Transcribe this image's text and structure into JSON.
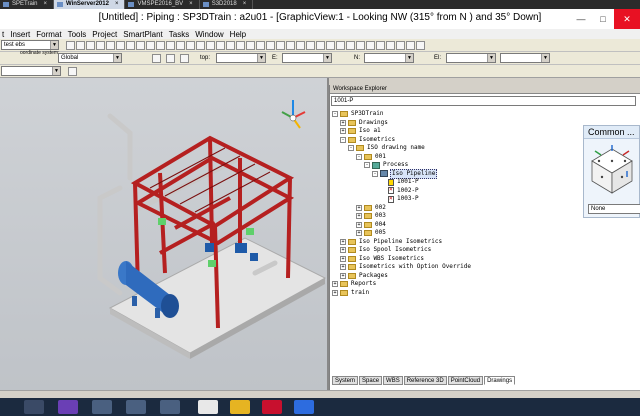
{
  "vm_tabs": [
    {
      "label": "SPETrain",
      "active": false
    },
    {
      "label": "WinServer2012",
      "active": true
    },
    {
      "label": "VMSPE2016_BV",
      "active": false
    },
    {
      "label": "S3D2018",
      "active": false
    }
  ],
  "window": {
    "title": "[Untitled] : Piping : SP3DTrain : a2u01 - [GraphicView:1 - Looking NW (315° from N ) and 35° Down]",
    "minimize": "—",
    "maximize": "□",
    "close": "✕"
  },
  "menu": [
    "t",
    "Insert",
    "Format",
    "Tools",
    "Project",
    "SmartPlant",
    "Tasks",
    "Window",
    "Help"
  ],
  "toolbar": {
    "filter_value": "test ebs",
    "coordinate_system_label": "oordinate system:",
    "coordinate_system_value": "Global",
    "top_label": "top:",
    "e_label": "E:",
    "n_label": "N:",
    "el_label": "El:"
  },
  "workspace_explorer": {
    "header": "Workspace Explorer",
    "search_value": "1001-P",
    "tree": [
      {
        "label": "SP3DTrain",
        "indent": 0,
        "kind": "root",
        "exp": "-"
      },
      {
        "label": "Drawings",
        "indent": 1,
        "kind": "folder",
        "exp": "+"
      },
      {
        "label": "Iso a1",
        "indent": 1,
        "kind": "folder",
        "exp": "+"
      },
      {
        "label": "Isometrics",
        "indent": 1,
        "kind": "folder",
        "exp": "-"
      },
      {
        "label": "ISO drawing name",
        "indent": 2,
        "kind": "folder",
        "exp": "-"
      },
      {
        "label": "001",
        "indent": 3,
        "kind": "folder",
        "exp": "-"
      },
      {
        "label": "Process",
        "indent": 4,
        "kind": "process",
        "exp": "-"
      },
      {
        "label": "Iso Pipeline",
        "indent": 5,
        "kind": "pipeline",
        "exp": "-",
        "selected": true
      },
      {
        "label": "1001-P",
        "indent": 6,
        "kind": "doc-yel"
      },
      {
        "label": "1002-P",
        "indent": 6,
        "kind": "doc-red"
      },
      {
        "label": "1003-P",
        "indent": 6,
        "kind": "doc-red"
      },
      {
        "label": "002",
        "indent": 3,
        "kind": "folder",
        "exp": "+"
      },
      {
        "label": "003",
        "indent": 3,
        "kind": "folder",
        "exp": "+"
      },
      {
        "label": "004",
        "indent": 3,
        "kind": "folder",
        "exp": "+"
      },
      {
        "label": "005",
        "indent": 3,
        "kind": "folder",
        "exp": "+"
      },
      {
        "label": "Iso Pipeline Isometrics",
        "indent": 1,
        "kind": "folder",
        "exp": "+"
      },
      {
        "label": "Iso Spool Isometrics",
        "indent": 1,
        "kind": "folder",
        "exp": "+"
      },
      {
        "label": "Iso WBS Isometrics",
        "indent": 1,
        "kind": "folder",
        "exp": "+"
      },
      {
        "label": "Isometrics with Option Override",
        "indent": 1,
        "kind": "folder",
        "exp": "+"
      },
      {
        "label": "Packages",
        "indent": 1,
        "kind": "folder",
        "exp": "+"
      },
      {
        "label": "Reports",
        "indent": 0,
        "kind": "folder",
        "exp": "+"
      },
      {
        "label": "train",
        "indent": 0,
        "kind": "folder",
        "exp": "+"
      }
    ],
    "tabs": [
      {
        "label": "System",
        "active": false
      },
      {
        "label": "Space",
        "active": false
      },
      {
        "label": "WBS",
        "active": false
      },
      {
        "label": "Reference 3D",
        "active": false
      },
      {
        "label": "PointCloud",
        "active": false
      },
      {
        "label": "Drawings",
        "active": true
      }
    ]
  },
  "common_panel": {
    "title": "Common ...",
    "value": "None"
  }
}
